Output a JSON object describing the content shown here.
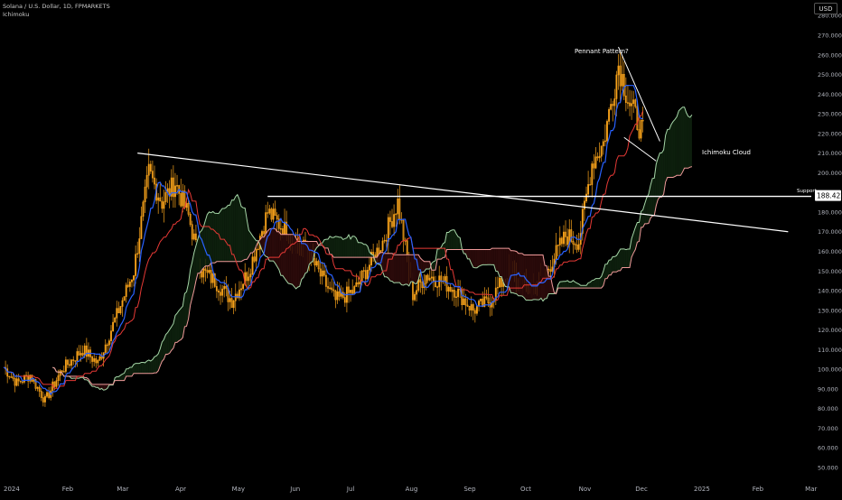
{
  "legend": {
    "symbol": "Solana / U.S. Dollar, 1D, FPMARKETS",
    "indicator": "Ichimoku"
  },
  "currency": "USD",
  "chart_data": {
    "type": "candlestick",
    "y_axis": {
      "min": 50,
      "max": 280,
      "step": 10,
      "tick_labels": [
        "280.000",
        "270.000",
        "260.000",
        "250.000",
        "240.000",
        "230.000",
        "220.000",
        "210.000",
        "200.000",
        "190.000",
        "180.000",
        "170.000",
        "160.000",
        "150.000",
        "140.000",
        "130.000",
        "120.000",
        "110.000",
        "100.000",
        "90.000",
        "80.000",
        "70.000",
        "60.000",
        "50.000"
      ]
    },
    "x_axis": {
      "start": "2024-01-01",
      "tick_labels": [
        "2024",
        "Feb",
        "Mar",
        "Apr",
        "May",
        "Jun",
        "Jul",
        "Aug",
        "Sep",
        "Oct",
        "Nov",
        "Dec",
        "2025",
        "Feb",
        "Mar"
      ],
      "tick_dates": [
        "2024-01-01",
        "2024-02-01",
        "2024-03-01",
        "2024-04-01",
        "2024-05-01",
        "2024-06-01",
        "2024-07-01",
        "2024-08-01",
        "2024-09-01",
        "2024-10-01",
        "2024-11-01",
        "2024-12-01",
        "2025-01-01",
        "2025-02-01",
        "2025-03-01"
      ]
    },
    "price_anchors": [
      {
        "date": "2024-01-01",
        "close": 101
      },
      {
        "date": "2024-01-08",
        "close": 93
      },
      {
        "date": "2024-01-15",
        "close": 97
      },
      {
        "date": "2024-01-23",
        "close": 84
      },
      {
        "date": "2024-02-01",
        "close": 100
      },
      {
        "date": "2024-02-12",
        "close": 110
      },
      {
        "date": "2024-02-20",
        "close": 103
      },
      {
        "date": "2024-02-29",
        "close": 125
      },
      {
        "date": "2024-03-10",
        "close": 150
      },
      {
        "date": "2024-03-18",
        "close": 200
      },
      {
        "date": "2024-03-25",
        "close": 185
      },
      {
        "date": "2024-04-01",
        "close": 195
      },
      {
        "date": "2024-04-08",
        "close": 178
      },
      {
        "date": "2024-04-15",
        "close": 150
      },
      {
        "date": "2024-04-22",
        "close": 145
      },
      {
        "date": "2024-05-01",
        "close": 135
      },
      {
        "date": "2024-05-10",
        "close": 150
      },
      {
        "date": "2024-05-20",
        "close": 180
      },
      {
        "date": "2024-06-01",
        "close": 168
      },
      {
        "date": "2024-06-10",
        "close": 160
      },
      {
        "date": "2024-06-18",
        "close": 146
      },
      {
        "date": "2024-06-25",
        "close": 135
      },
      {
        "date": "2024-07-05",
        "close": 140
      },
      {
        "date": "2024-07-20",
        "close": 165
      },
      {
        "date": "2024-07-28",
        "close": 185
      },
      {
        "date": "2024-08-05",
        "close": 138
      },
      {
        "date": "2024-08-12",
        "close": 148
      },
      {
        "date": "2024-08-20",
        "close": 145
      },
      {
        "date": "2024-08-28",
        "close": 140
      },
      {
        "date": "2024-09-06",
        "close": 130
      },
      {
        "date": "2024-09-15",
        "close": 135
      },
      {
        "date": "2024-09-25",
        "close": 150
      },
      {
        "date": "2024-10-05",
        "close": 140
      },
      {
        "date": "2024-10-15",
        "close": 150
      },
      {
        "date": "2024-10-25",
        "close": 168
      },
      {
        "date": "2024-11-01",
        "close": 165
      },
      {
        "date": "2024-11-08",
        "close": 205
      },
      {
        "date": "2024-11-14",
        "close": 215
      },
      {
        "date": "2024-11-22",
        "close": 255
      },
      {
        "date": "2024-11-28",
        "close": 235
      },
      {
        "date": "2024-12-05",
        "close": 220
      }
    ],
    "ichimoku": {
      "tenkan_color": "#2962ff",
      "kijun_color": "#e53935",
      "span_a_color": "#a5d6a7",
      "span_b_color": "#ef9a9a",
      "cloud_green_fill": "#0d1f0d",
      "cloud_red_fill": "#2a0a0a"
    },
    "candle_colors": {
      "up": "#f7a21b",
      "down": "#f7a21b",
      "wick": "#f7a21b"
    },
    "annotations": {
      "pennant_label": "Pennant Pattern?",
      "cloud_label": "Ichimoku Cloud",
      "support_label": "Support",
      "support_price": "188.422"
    },
    "trendlines": {
      "resistance": [
        {
          "date": "2024-03-12",
          "price": 210
        },
        {
          "date": "2025-02-20",
          "price": 170
        }
      ],
      "support": {
        "from": "2024-05-20",
        "to": "2025-03-10",
        "price": 188
      }
    }
  }
}
